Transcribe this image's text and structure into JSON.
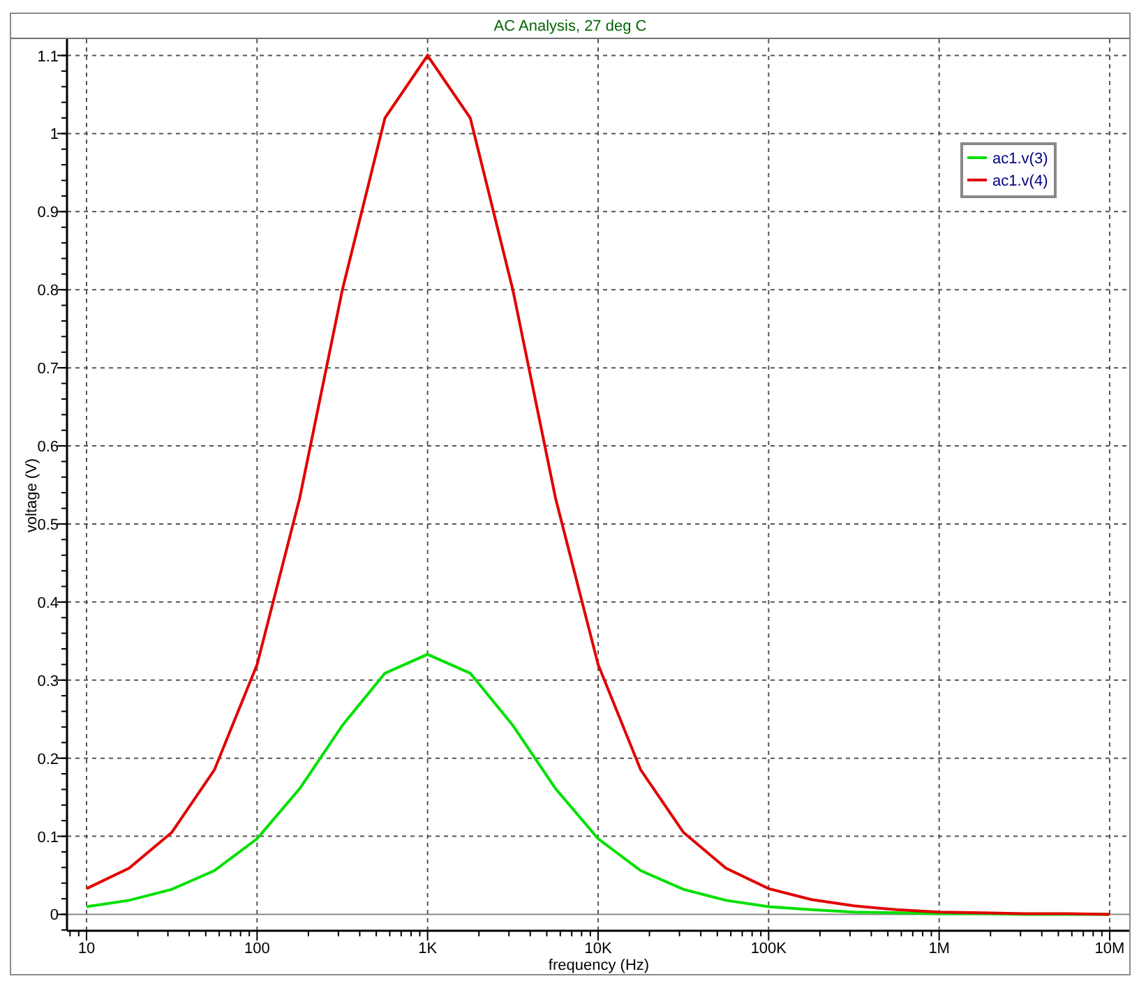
{
  "chart_data": {
    "type": "line",
    "title": "AC Analysis, 27 deg C",
    "xlabel": "frequency (Hz)",
    "ylabel": "voltage (V)",
    "categories": [
      "10",
      null,
      null,
      null,
      "100",
      null,
      null,
      null,
      "1K",
      null,
      null,
      null,
      "10K",
      null,
      null,
      null,
      "100K",
      null,
      null,
      null,
      "1M",
      null,
      null,
      null,
      "10M"
    ],
    "series": [
      {
        "name": "ac1.v(3)",
        "color": "#00e000",
        "values": [
          0.01,
          0.018,
          0.032,
          0.056,
          0.097,
          0.161,
          0.242,
          0.309,
          0.333,
          0.309,
          0.242,
          0.161,
          0.097,
          0.056,
          0.032,
          0.018,
          0.01,
          0.006,
          0.003,
          0.002,
          0.001,
          0.001,
          0,
          0,
          0
        ]
      },
      {
        "name": "ac1.v(4)",
        "color": "#e00000",
        "values": [
          0.033,
          0.059,
          0.105,
          0.185,
          0.32,
          0.533,
          0.8,
          1.02,
          1.1,
          1.02,
          0.8,
          0.533,
          0.32,
          0.185,
          0.105,
          0.059,
          0.033,
          0.019,
          0.011,
          0.006,
          0.003,
          0.002,
          0.001,
          0.001,
          0
        ]
      }
    ],
    "ylim": [
      -0.021,
      1.121
    ],
    "grid": true,
    "legend": true,
    "yticks": [
      0,
      0.1,
      0.2,
      0.3,
      0.4,
      0.5,
      0.6,
      0.7,
      0.8,
      0.9,
      1,
      1.1
    ]
  }
}
